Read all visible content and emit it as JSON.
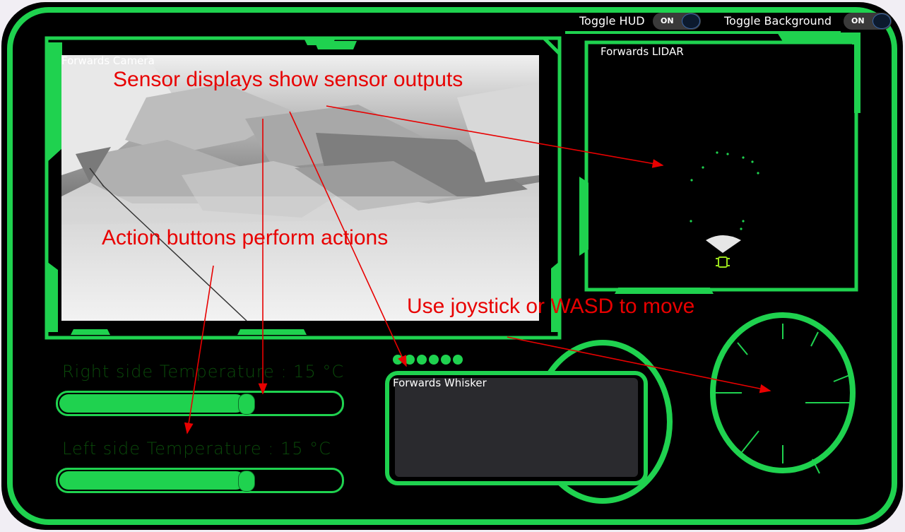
{
  "hud": {
    "toggle_hud_label": "Toggle HUD",
    "toggle_hud_state": "ON",
    "toggle_background_label": "Toggle Background",
    "toggle_background_state": "ON"
  },
  "camera": {
    "title": "Forwards Camera"
  },
  "lidar": {
    "title": "Forwards LIDAR"
  },
  "whisker": {
    "title": "Forwards Whisker",
    "indicator_count": 6
  },
  "temperatures": [
    {
      "label": "Right side Temperature : 15 °C",
      "level": 0.66
    },
    {
      "label": "Left side Temperature : 15 °C",
      "level": 0.66
    }
  ],
  "annotations": {
    "sensor": "Sensor displays show sensor outputs",
    "action": "Action buttons perform actions",
    "move": "Use joystick or WASD to move"
  },
  "colors": {
    "accent": "#1fd24f",
    "background": "#000000",
    "annotation": "#e80000",
    "lidar_points": "#1fd24f",
    "robot_icon": "#9be21b"
  },
  "icons": {
    "robot": "robot-icon",
    "joystick": "joystick-dial-icon"
  }
}
